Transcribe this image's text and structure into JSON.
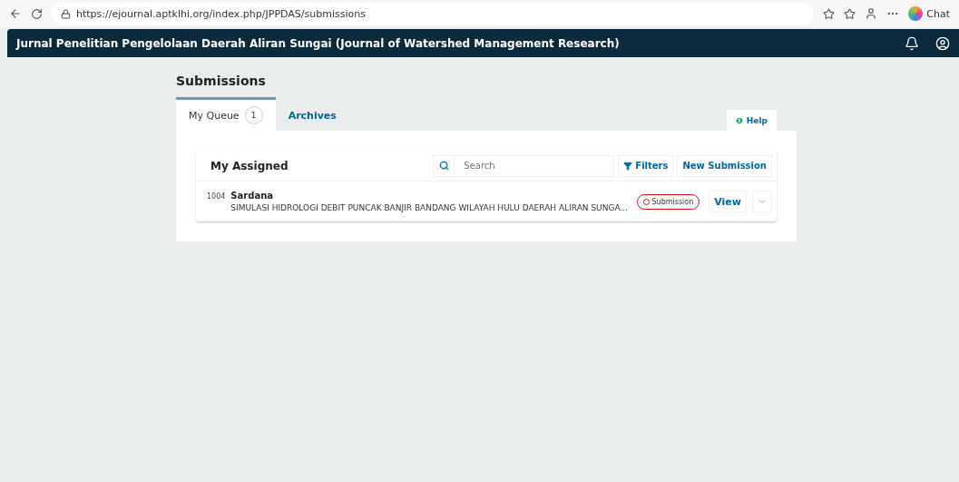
{
  "browser": {
    "url": "https://ejournal.aptklhi.org/index.php/JPPDAS/submissions",
    "chat_label": "Chat"
  },
  "header": {
    "title": "Jurnal Penelitian Pengelolaan Daerah Aliran Sungai (Journal of Watershed Management Research)"
  },
  "page": {
    "title": "Submissions"
  },
  "tabs": [
    {
      "label": "My Queue",
      "count": "1",
      "selected": true
    },
    {
      "label": "Archives",
      "selected": false
    }
  ],
  "help": {
    "icon": "❶",
    "label": "Help"
  },
  "list": {
    "title": "My Assigned",
    "search": {
      "placeholder": "Search"
    },
    "filters_label": "Filters",
    "new_label": "New Submission",
    "items": [
      {
        "id": "1004",
        "author": "Sardana",
        "title": "SIMULASI HIDROLOGI DEBIT PUNCAK BANJIR BANDANG WILAYAH HULU DAERAH ALIRAN SUNGA...",
        "stage": "Submission",
        "view_label": "View"
      }
    ]
  }
}
